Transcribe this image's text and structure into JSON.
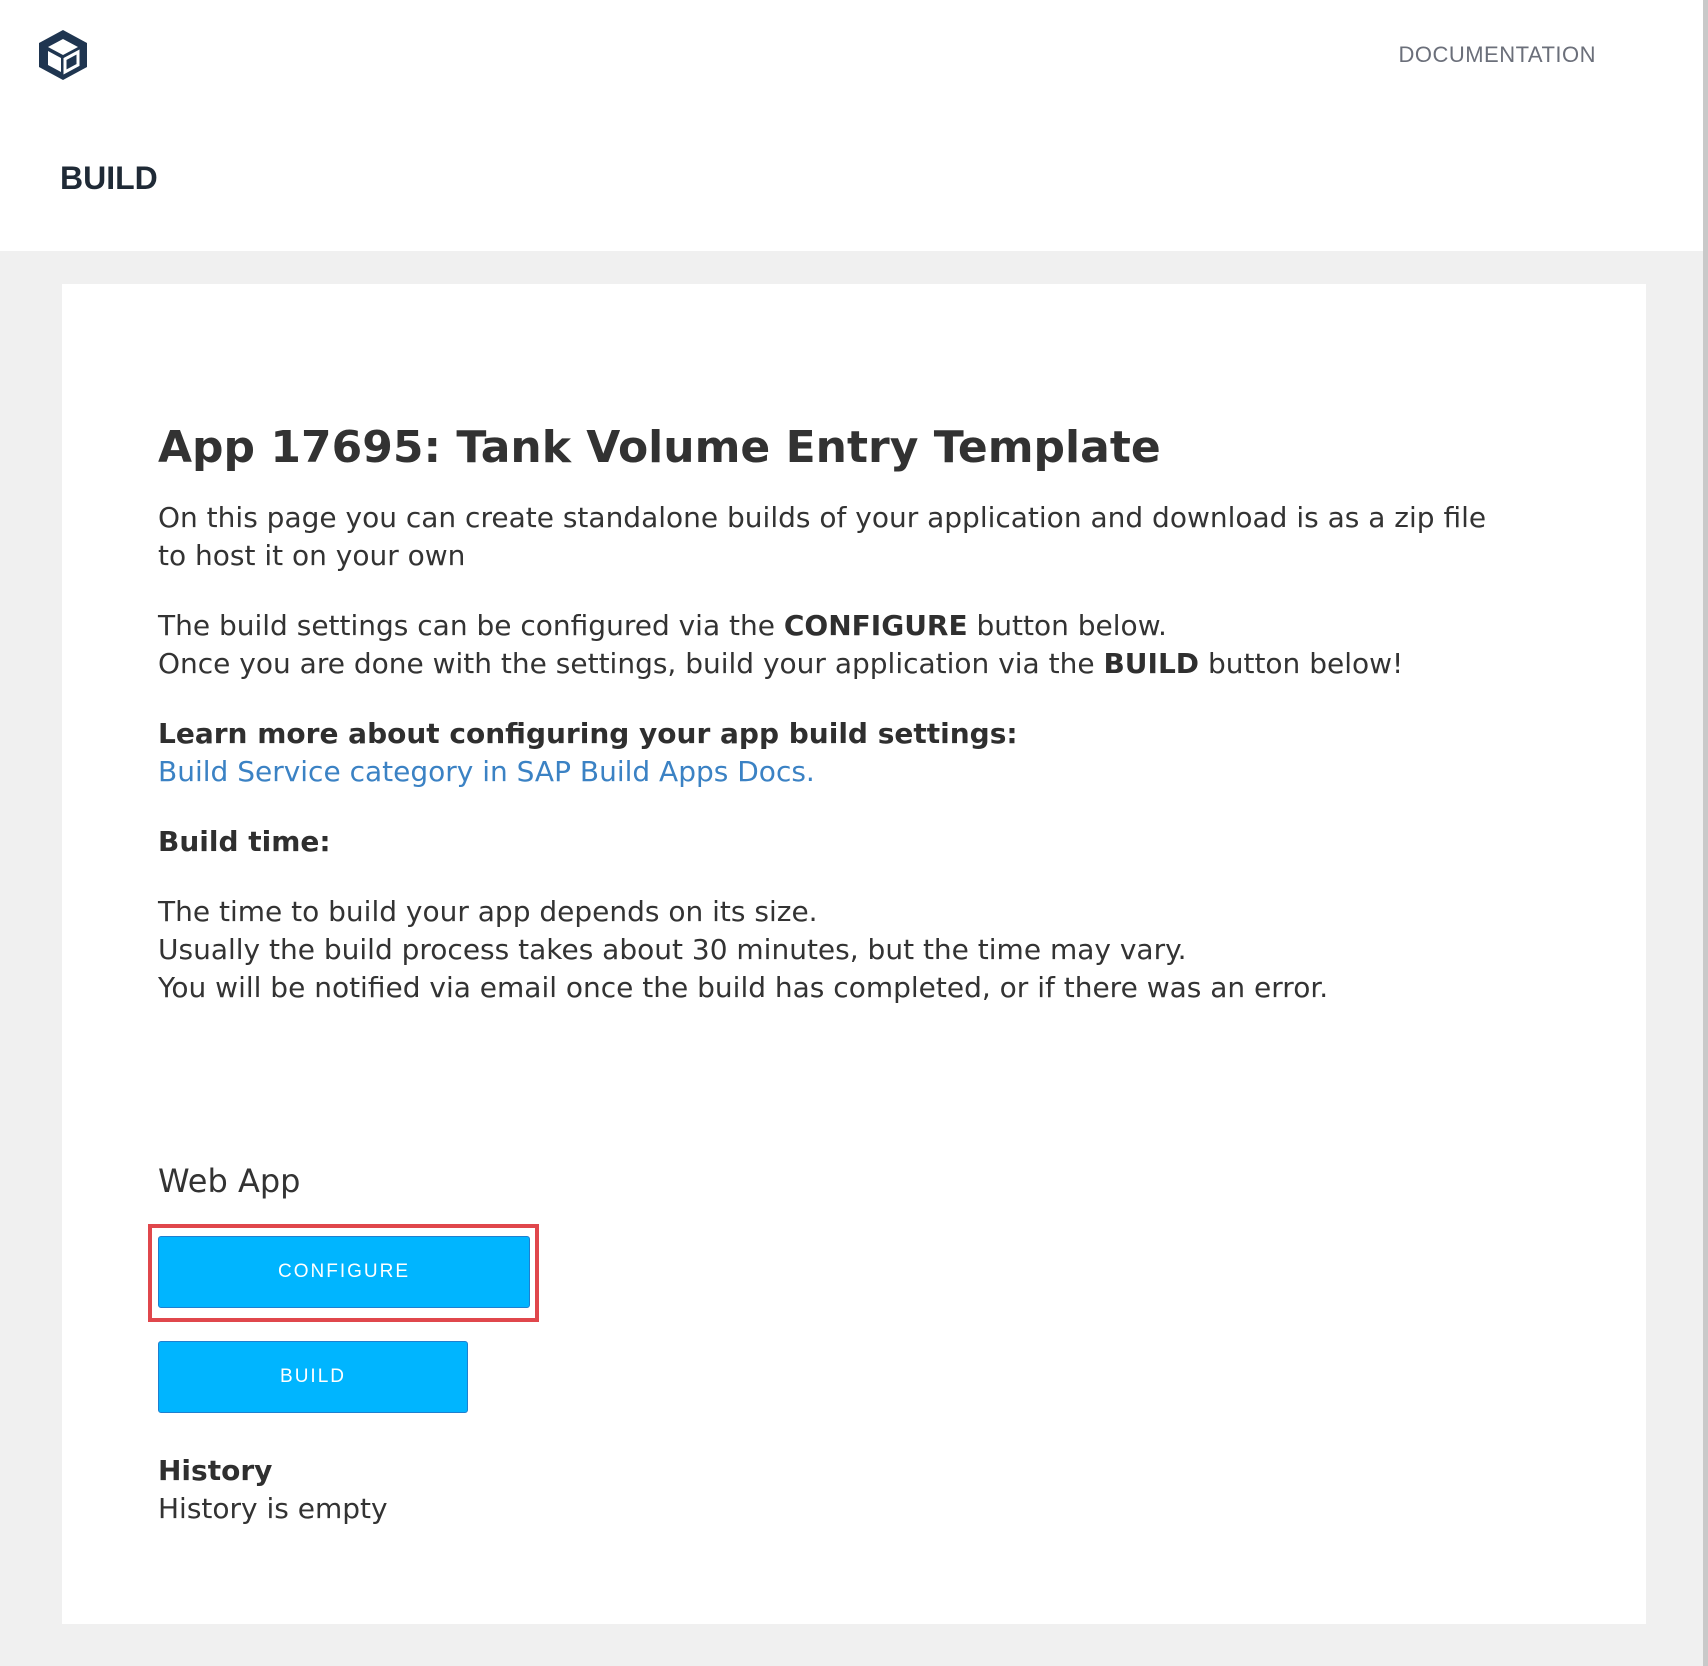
{
  "header": {
    "logo_icon": "app-logo-icon",
    "documentation_label": "DOCUMENTATION",
    "page_heading": "BUILD"
  },
  "main": {
    "title": "App 17695: Tank Volume Entry Template",
    "intro": "On this page you can create standalone builds of your application and download is as a zip file to host it on your own",
    "configure_line_prefix": "The build settings can be configured via the ",
    "configure_keyword": "CONFIGURE",
    "configure_line_suffix": " button below.",
    "build_line_prefix": "Once you are done with the settings, build your application via the ",
    "build_keyword": "BUILD",
    "build_line_suffix": " button below!",
    "learn_more_label": "Learn more about configuring your app build settings:",
    "docs_link_text": "Build Service category in SAP Build Apps Docs.",
    "build_time_label": "Build time:",
    "build_time_lines": [
      "The time to build your app depends on its size.",
      "Usually the build process takes about 30 minutes, but the time may vary.",
      "You will be notified via email once the build has completed, or if there was an error."
    ]
  },
  "web_app": {
    "label": "Web App",
    "configure_button": "CONFIGURE",
    "build_button": "BUILD"
  },
  "history": {
    "title": "History",
    "empty_text": "History is empty"
  },
  "colors": {
    "button_bg": "#00b5ff",
    "highlight_border": "#e0474c",
    "link": "#3b82c4",
    "page_bg": "#f0f0f0"
  }
}
